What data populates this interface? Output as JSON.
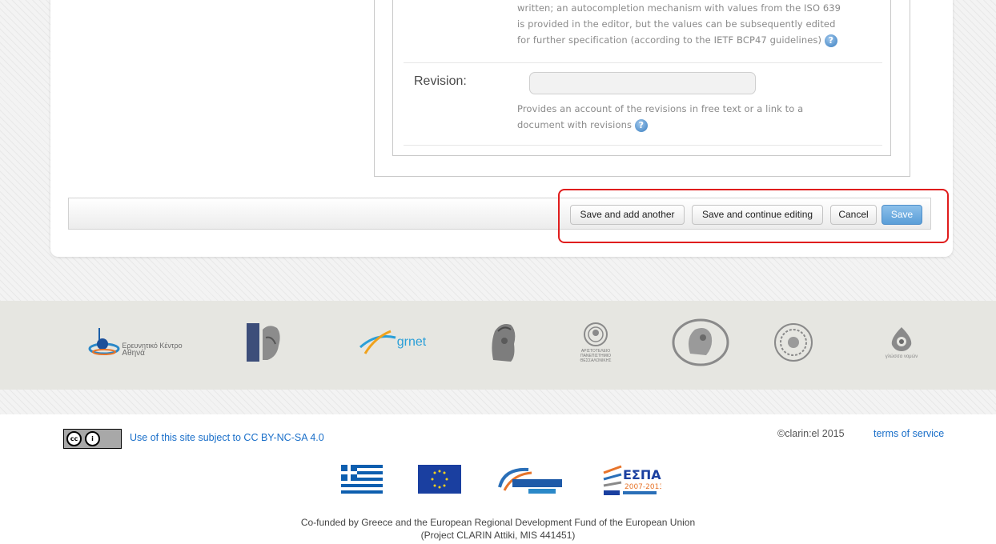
{
  "form": {
    "language_help_lines": [
      "written; an autocompletion mechanism with values from the ISO 639",
      "is provided in the editor, but the values can be subsequently edited",
      "for further specification (according to the IETF BCP47 guidelines)"
    ],
    "revision_label": "Revision:",
    "revision_value": "",
    "revision_help_lines": [
      "Provides an account of the revisions in free text or a link to a",
      "document with revisions"
    ],
    "help_icon": "question-circle-icon"
  },
  "actions": {
    "save_add_another": "Save and add another",
    "save_continue": "Save and continue editing",
    "cancel": "Cancel",
    "save": "Save"
  },
  "partners": {
    "athena_line1": "Ερευνητικό Κέντρο",
    "athena_line2": "Αθηνά",
    "grnet": "grnet",
    "auth_lines": [
      "ΑΡΙΣΤΟΤΕΛΕΙΟ",
      "ΠΑΝΕΠΙΣΤΗΜΙΟ",
      "ΘΕΣΣΑΛΟΝΙΚΗΣ"
    ],
    "glossa_text": "γλώσσα νομών"
  },
  "footer": {
    "cc_text": "Use of this site subject to CC BY-NC-SA 4.0",
    "copyright": "©clarin:el 2015",
    "terms": "terms of service",
    "espa_title": "ΕΣΠΑ",
    "espa_years": "2007-2013",
    "cofund_line1": "Co-funded by Greece and the European Regional Development Fund of the European Union",
    "cofund_line2": "(Project CLARIN Attiki, MIS 441451)"
  },
  "colors": {
    "link": "#1a6fc9",
    "highlight": "#e01d1d",
    "primary_button": "#5a9ed8"
  }
}
